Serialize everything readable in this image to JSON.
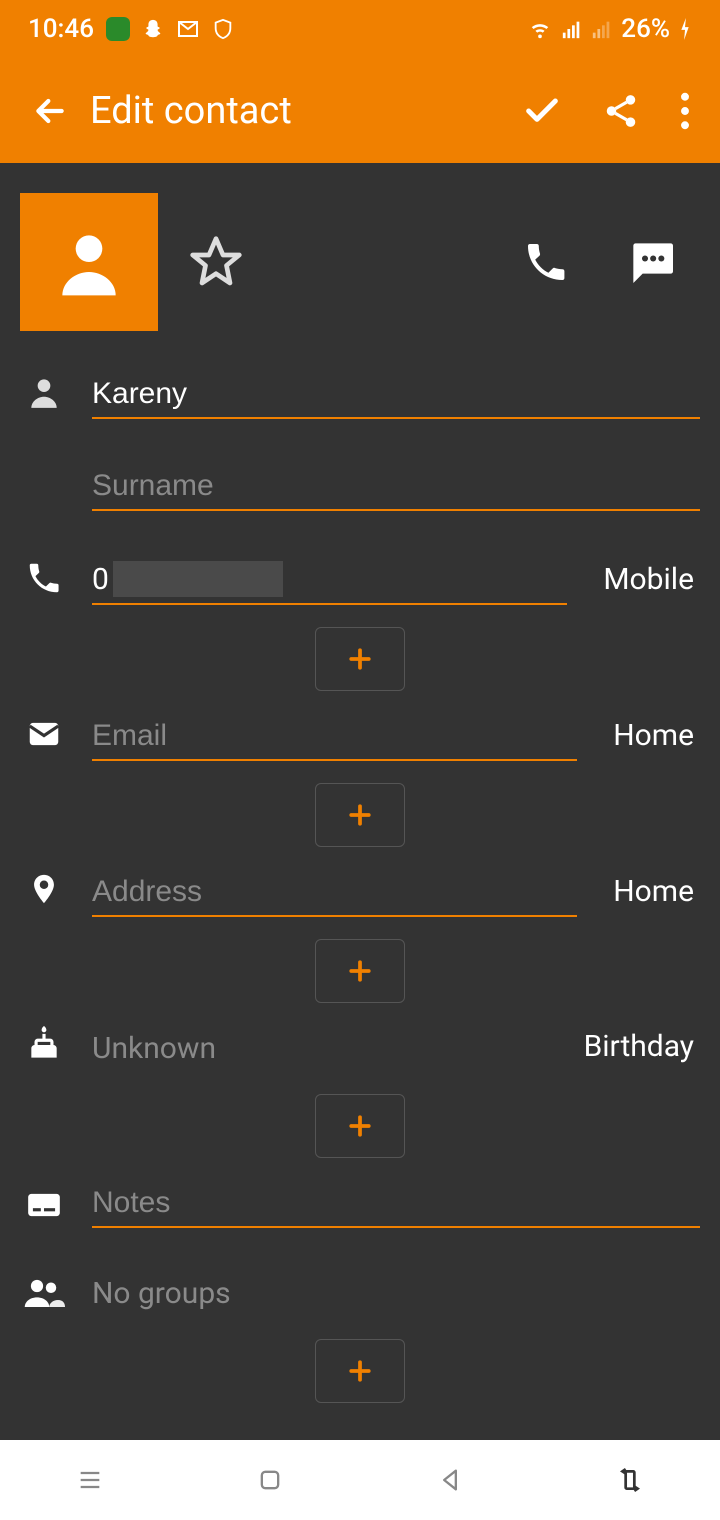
{
  "status": {
    "time": "10:46",
    "battery": "26%"
  },
  "appbar": {
    "title": "Edit contact"
  },
  "contact": {
    "first_name": "Kareny",
    "surname_placeholder": "Surname",
    "phone_prefix": "0",
    "phone_type": "Mobile",
    "email_placeholder": "Email",
    "email_type": "Home",
    "address_placeholder": "Address",
    "address_type": "Home",
    "event_placeholder": "Unknown",
    "event_type": "Birthday",
    "notes_placeholder": "Notes",
    "groups_text": "No groups"
  }
}
